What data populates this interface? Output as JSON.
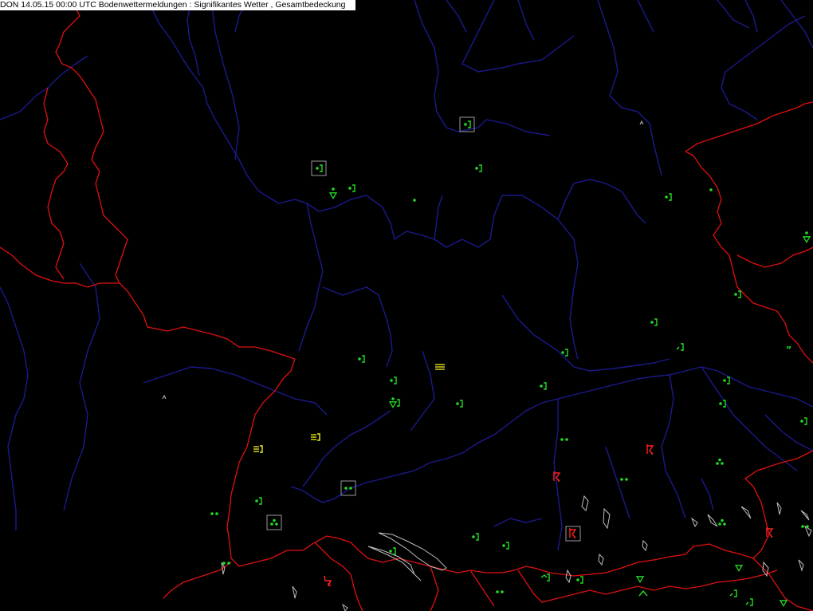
{
  "header": {
    "title": "DON 14.05.15 00:00 UTC  Bodenwettermeldungen :  Signifikantes Wetter , Gesamtbedeckung"
  },
  "colors": {
    "background": "#000000",
    "rivers": "#1a1a8c",
    "borders": "#e01010",
    "lakes": "#bfbfbf",
    "rain_symbol": "#22dd22",
    "fog_symbol": "#f0f020",
    "thunder_symbol": "#ff2020",
    "station_box": "#9a9a9a"
  },
  "symbol_legend": {
    "rain_dot_bracket": "rain, ended (dot + bracket)",
    "two_dots": "intermittent moderate rain",
    "triangle_dot": "rain shower",
    "fog_lines": "fog",
    "thunder": "thunderstorm",
    "triangle": "shower"
  },
  "map": {
    "icons": [
      {
        "id": "s1",
        "type": "rain_dot_bracket",
        "boxed": true
      },
      {
        "id": "s2",
        "type": "rain_dot_bracket",
        "boxed": true
      },
      {
        "id": "s3",
        "type": "rain_dot_bracket",
        "boxed": false
      },
      {
        "id": "s4",
        "type": "rain_dot_bracket",
        "boxed": false
      },
      {
        "id": "s5",
        "type": "triangle_dot",
        "boxed": false
      },
      {
        "id": "s6",
        "type": "rain_dot",
        "boxed": false
      },
      {
        "id": "s7",
        "type": "rain_dot_bracket",
        "boxed": false
      },
      {
        "id": "s8",
        "type": "rain_dot",
        "boxed": false
      },
      {
        "id": "s9",
        "type": "triangle_dot",
        "boxed": false
      },
      {
        "id": "s10",
        "type": "rain_dot_bracket",
        "boxed": false
      },
      {
        "id": "s11",
        "type": "rain_dot_bracket",
        "boxed": false
      },
      {
        "id": "s12",
        "type": "rain_dot_bracket",
        "boxed": false
      },
      {
        "id": "s13",
        "type": "rain_bracket",
        "boxed": false
      },
      {
        "id": "s14",
        "type": "drizzle",
        "boxed": false
      },
      {
        "id": "s15",
        "type": "rain_dot_bracket",
        "boxed": false
      },
      {
        "id": "s16",
        "type": "fog_lines",
        "boxed": false
      },
      {
        "id": "s17",
        "type": "rain_dot_bracket",
        "boxed": false
      },
      {
        "id": "s18",
        "type": "rain_dot_bracket",
        "boxed": false
      },
      {
        "id": "s19",
        "type": "triangle_dot_bracket",
        "boxed": false
      },
      {
        "id": "s20",
        "type": "rain_dot_bracket",
        "boxed": false
      },
      {
        "id": "s21",
        "type": "rain_dot_bracket",
        "boxed": false
      },
      {
        "id": "s22",
        "type": "rain_dot_bracket",
        "boxed": false
      },
      {
        "id": "s23",
        "type": "rain_dot_bracket",
        "boxed": false
      },
      {
        "id": "s24",
        "type": "fog_lines_bracket",
        "boxed": false
      },
      {
        "id": "s25",
        "type": "fog_lines_bracket",
        "boxed": false
      },
      {
        "id": "s26",
        "type": "two_dots",
        "boxed": false
      },
      {
        "id": "s27",
        "type": "thunder",
        "boxed": false
      },
      {
        "id": "s28",
        "type": "two_dots",
        "boxed": false
      },
      {
        "id": "s29",
        "type": "thunder",
        "boxed": false
      },
      {
        "id": "s30",
        "type": "two_dots",
        "boxed": true
      },
      {
        "id": "s31",
        "type": "rain_dot_bracket",
        "boxed": false
      },
      {
        "id": "s32",
        "type": "two_dots",
        "boxed": false
      },
      {
        "id": "s33",
        "type": "three_dots",
        "boxed": true
      },
      {
        "id": "s34",
        "type": "three_dots",
        "boxed": false
      },
      {
        "id": "s35",
        "type": "thunder",
        "boxed": true
      },
      {
        "id": "s36",
        "type": "rain_dot_bracket",
        "boxed": false
      },
      {
        "id": "s37",
        "type": "rain_dot_bracket",
        "boxed": false
      },
      {
        "id": "s38",
        "type": "rain_dot_bracket",
        "boxed": false
      },
      {
        "id": "s39",
        "type": "two_dots",
        "boxed": false
      },
      {
        "id": "s40",
        "type": "thunder_arrow",
        "boxed": false
      },
      {
        "id": "s41",
        "type": "bracket_hook",
        "boxed": false
      },
      {
        "id": "s42",
        "type": "rain_dot_bracket",
        "boxed": false
      },
      {
        "id": "s43",
        "type": "triangle",
        "boxed": false
      },
      {
        "id": "s44",
        "type": "hook",
        "boxed": false
      },
      {
        "id": "s45",
        "type": "triangle",
        "boxed": false
      },
      {
        "id": "s46",
        "type": "two_dots",
        "boxed": false
      },
      {
        "id": "s47",
        "type": "three_dots",
        "boxed": false
      },
      {
        "id": "s48",
        "type": "rain_bracket",
        "boxed": false
      },
      {
        "id": "s49",
        "type": "rain_bracket",
        "boxed": false
      },
      {
        "id": "s50",
        "type": "triangle",
        "boxed": false
      },
      {
        "id": "s51",
        "type": "thunder",
        "boxed": false
      },
      {
        "id": "s52",
        "type": "two_dots",
        "boxed": false
      },
      {
        "id": "s53",
        "type": "small_mark",
        "boxed": false
      },
      {
        "id": "s54",
        "type": "small_mark",
        "boxed": false
      }
    ]
  }
}
